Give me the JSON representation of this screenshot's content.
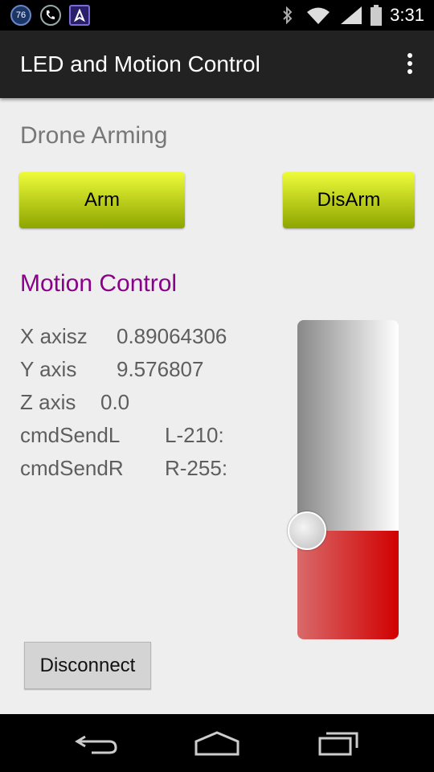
{
  "status_bar": {
    "notif_badge": "76",
    "time": "3:31",
    "icons": [
      "badge-76-icon",
      "phone-icon",
      "nav-app-icon",
      "bluetooth-icon",
      "wifi-icon",
      "signal-icon",
      "battery-icon"
    ]
  },
  "action_bar": {
    "title": "LED and Motion Control",
    "menu_icon": "overflow-menu-icon"
  },
  "arming": {
    "title": "Drone Arming",
    "arm_label": "Arm",
    "disarm_label": "DisArm"
  },
  "motion": {
    "title": "Motion Control",
    "title_color": "#8a008a",
    "x_label": "X axisz",
    "x_value": "0.89064306",
    "y_label": "Y axis",
    "y_value": "9.576807",
    "z_label": "Z axis",
    "z_value": "0.0",
    "left_label": "cmdSendL",
    "left_value": "L-210:",
    "right_label": "cmdSendR",
    "right_value": "R-255:"
  },
  "slider": {
    "level": 0.34,
    "fill_color": "#d10000"
  },
  "footer": {
    "disconnect_label": "Disconnect"
  },
  "nav_bar": {
    "icons": [
      "back-icon",
      "home-icon",
      "recents-icon"
    ]
  }
}
